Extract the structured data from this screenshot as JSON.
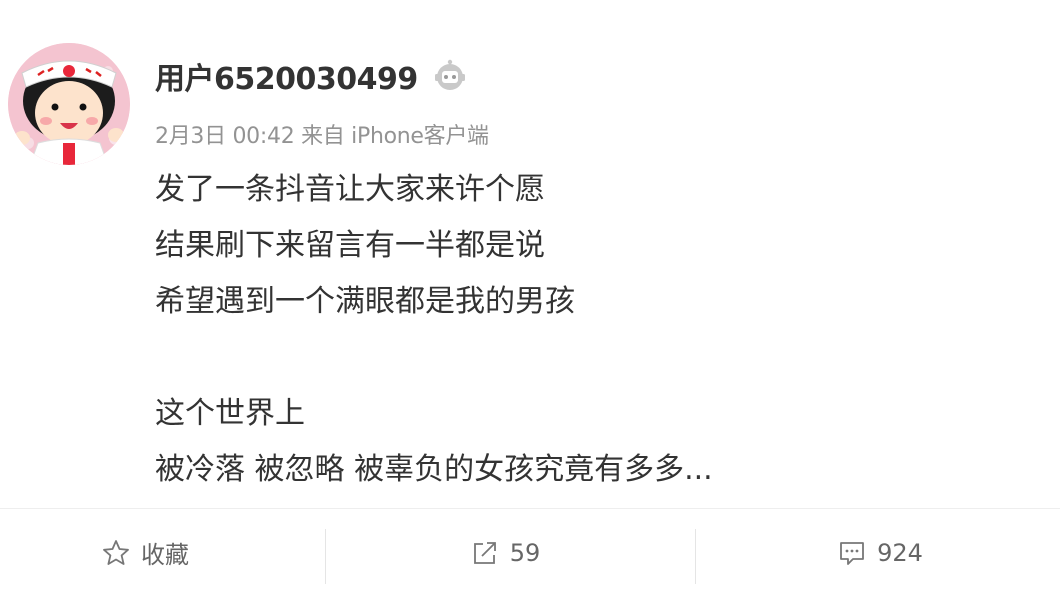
{
  "post": {
    "username": "用户6520030499",
    "meta": "2月3日 00:42 来自 iPhone客户端",
    "lines": [
      "发了一条抖音让大家来许个愿",
      "结果刷下来留言有一半都是说",
      "希望遇到一个满眼都是我的男孩",
      "",
      "这个世界上",
      "被冷落 被忽略 被辜负的女孩究竟有多多..."
    ]
  },
  "actions": {
    "favorite_label": "收藏",
    "share_count": "59",
    "comment_count": "924"
  },
  "icons": {
    "favorite": "star-outline-icon",
    "share": "share-arrow-icon",
    "comment": "comment-bubble-icon",
    "badge": "robot-badge-icon"
  },
  "colors": {
    "text": "#333333",
    "meta": "#939393",
    "action": "#666666",
    "divider": "#eeeeee"
  }
}
